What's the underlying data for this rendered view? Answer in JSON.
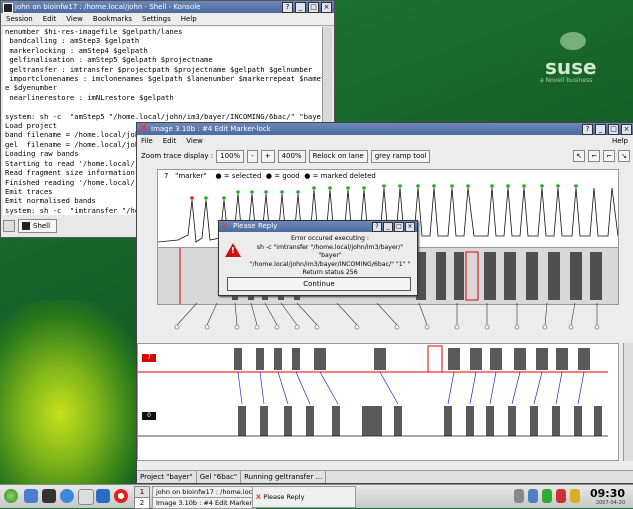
{
  "desktop": {
    "brand": "suse",
    "brand_sub": "a Novell business"
  },
  "konsole": {
    "title": "john on bioinfw17 : /home.local/john - Shell - Konsole",
    "menu": [
      "Session",
      "Edit",
      "View",
      "Bookmarks",
      "Settings",
      "Help"
    ],
    "lines": [
      "nenumber $hi-res-imagefile $gelpath/lanes",
      " bandcalling : amStep3 $gelpath",
      " markerlocking : amStep4 $gelpath",
      " gelfinalisation : amStep5 $gelpath $projectname",
      " geltransfer : imtransfer $projectpath $projectname $gelpath $gelnumber",
      " importclonenames : imclonenames $gelpath $lanenumber $markerrepeat $nametemplat",
      "e $dyenumber",
      " nearlinerestore : imNLrestore $gelpath",
      "",
      "system: sh -c  \"amStep5 \"/home.local/john/im3/bayer/INCOMING/6bac/\" \"bayer\" \"",
      "Load project",
      "band filename = /home.local/john/im3/bayer/INCOMING/6bac/1.bands",
      "gel  filename = /home.local/john/im3/bayer/INCOMING/6bac/1.gel",
      "Loading raw bands",
      "Starting to read '/home.local/john",
      "Read fragment size information as",
      "Finished reading '/home.local/john",
      "Emit traces",
      "Emit normalised bands",
      "system: sh -c  \"imtransfer \"/home",
      "hn/im3/bayer/INCOMING/6bac/\" \"1\"",
      "FPCTOP_DIR: Undefined variable.",
      "Unmatched \"."
    ],
    "tab": "Shell"
  },
  "image_window": {
    "title": "Image 3.10b : #4 Edit Marker-lock",
    "menu": [
      "File",
      "Edit",
      "View"
    ],
    "help": "Help",
    "zoom_label": "Zoom trace display :",
    "zoom_value": "100%",
    "minus": "-",
    "plus": "+",
    "zoom_max": "400%",
    "relock": "Relock on lane",
    "grey_ramp": "grey ramp tool",
    "tool_icons": [
      "↖",
      "⌐",
      "⌐",
      "↘"
    ],
    "trace_header": "7   \"marker\"    ● = selected  ● = good  ● = marked deleted",
    "lane_labels": [
      "7",
      "0"
    ],
    "status": [
      "Project \"bayer\"",
      "Gel \"6bac\"",
      "Running geltransfer ..."
    ]
  },
  "dialog": {
    "title": "Please Reply",
    "message": [
      "Error occured executing :",
      "sh -c  \"imtransfer \"/home.local/john/im3/bayer/\"",
      "\"bayer\" \"/home.local/john/im3/bayer/INCOMING/6bac/\" \"1\" \"",
      "Return status 256"
    ],
    "button": "Continue"
  },
  "taskbar": {
    "tasks": [
      "john on bioinfw17 : /home.local/",
      "Image 3.10b : #4 Edit Marker-lock",
      "Please Reply"
    ],
    "pager": [
      "1",
      "2"
    ],
    "time": "09:30",
    "date": "2007-04-20"
  },
  "colors": {
    "selected": "#e02020",
    "good": "#20b020",
    "deleted": "#2030d0"
  }
}
